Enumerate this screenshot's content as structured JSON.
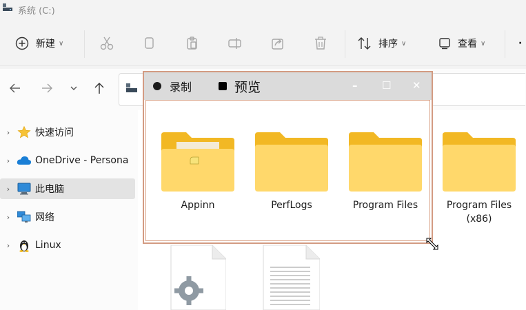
{
  "window": {
    "title": "系统 (C:)"
  },
  "toolbar": {
    "new_label": "新建",
    "sort_label": "排序",
    "view_label": "查看",
    "more_label": "·"
  },
  "sidebar": {
    "items": [
      {
        "label": "快速访问",
        "icon": "star-icon"
      },
      {
        "label": "OneDrive - Persona",
        "icon": "cloud-icon"
      },
      {
        "label": "此电脑",
        "icon": "monitor-icon"
      },
      {
        "label": "网络",
        "icon": "network-icon"
      },
      {
        "label": "Linux",
        "icon": "penguin-icon"
      }
    ]
  },
  "recorder": {
    "record_label": "录制",
    "preview_label": "预览",
    "minimize_label": "–",
    "maximize_label": "☐",
    "close_label": "✕"
  },
  "folders": [
    {
      "name": "Appinn"
    },
    {
      "name": "PerfLogs"
    },
    {
      "name": "Program Files"
    },
    {
      "name": "Program Files",
      "name_line2": "(x86)"
    }
  ],
  "colors": {
    "folder_back": "#f2b824",
    "folder_front": "#ffd86b",
    "accent_border": "#d39b82",
    "selected_bg": "#e3e3e3"
  }
}
